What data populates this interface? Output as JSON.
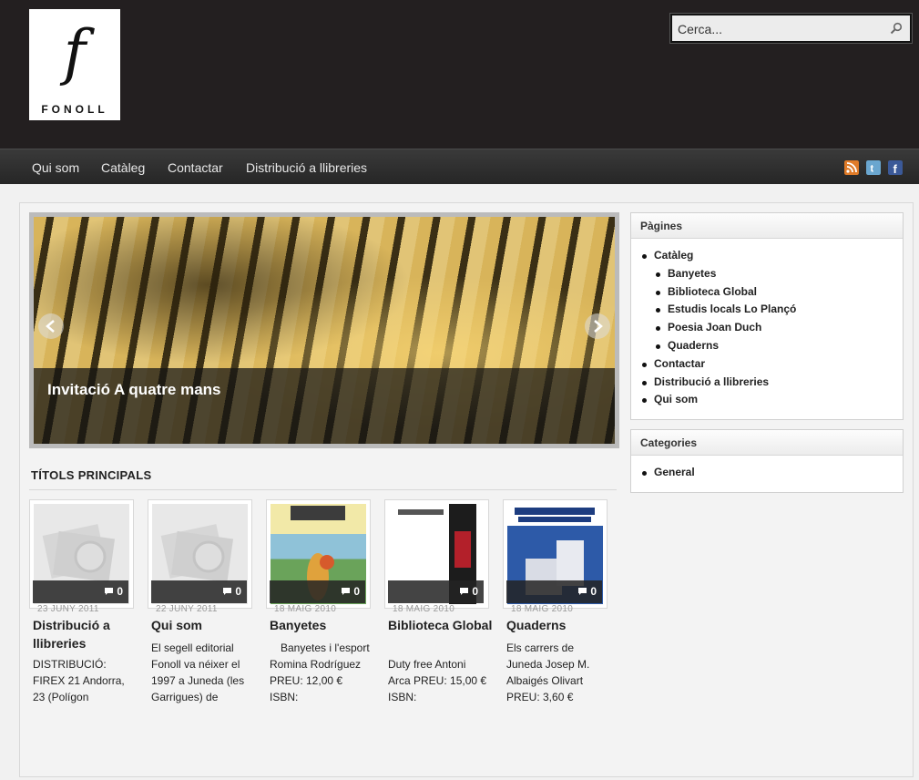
{
  "header": {
    "logo_letter": "f",
    "logo_word": "FONOLL",
    "search_placeholder": "Cerca..."
  },
  "nav": {
    "items": [
      "Qui som",
      "Catàleg",
      "Contactar",
      "Distribució a llibreries"
    ],
    "social_icons": [
      "rss-icon",
      "twitter-icon",
      "facebook-icon"
    ]
  },
  "slider": {
    "caption": "Invitació A quatre mans"
  },
  "principal": {
    "heading": "TÍTOLS PRINCIPALS",
    "posts": [
      {
        "date": "23 JUNY 2011",
        "title": "Distribució a llibreries",
        "excerpt": "DISTRIBUCIÓ: FIREX 21 Andorra, 23 (Polígon",
        "comments": "0"
      },
      {
        "date": "22 JUNY 2011",
        "title": "Qui som",
        "excerpt": "El segell editorial Fonoll va néixer el 1997 a Juneda (les Garrigues) de",
        "comments": "0"
      },
      {
        "date": "18 MAIG 2010",
        "title": "Banyetes",
        "excerpt": "Banyetes i l'esport Romina Rodríguez PREU: 12,00 € ISBN:",
        "comments": "0"
      },
      {
        "date": "18 MAIG 2010",
        "title": "Biblioteca Global",
        "excerpt": "Duty free Antoni Arca PREU: 15,00 € ISBN:",
        "comments": "0"
      },
      {
        "date": "18 MAIG 2010",
        "title": "Quaderns",
        "excerpt": "Els carrers de Juneda Josep M. Albaigés Olivart PREU: 3,60 €",
        "comments": "0"
      }
    ]
  },
  "sidebar": {
    "pages_title": "Pàgines",
    "pages": [
      {
        "label": "Catàleg",
        "level": 1
      },
      {
        "label": "Banyetes",
        "level": 2
      },
      {
        "label": "Biblioteca Global",
        "level": 2
      },
      {
        "label": "Estudis locals Lo Plançó",
        "level": 2
      },
      {
        "label": "Poesia Joan Duch",
        "level": 2
      },
      {
        "label": "Quaderns",
        "level": 2
      },
      {
        "label": "Contactar",
        "level": 1
      },
      {
        "label": "Distribució a llibreries",
        "level": 1
      },
      {
        "label": "Qui som",
        "level": 1
      }
    ],
    "categories_title": "Categories",
    "categories": [
      "General"
    ]
  },
  "colors": {
    "header_bg": "#231f20",
    "nav_bg": "#2f2f2f",
    "page_bg": "#f1f1f1"
  }
}
